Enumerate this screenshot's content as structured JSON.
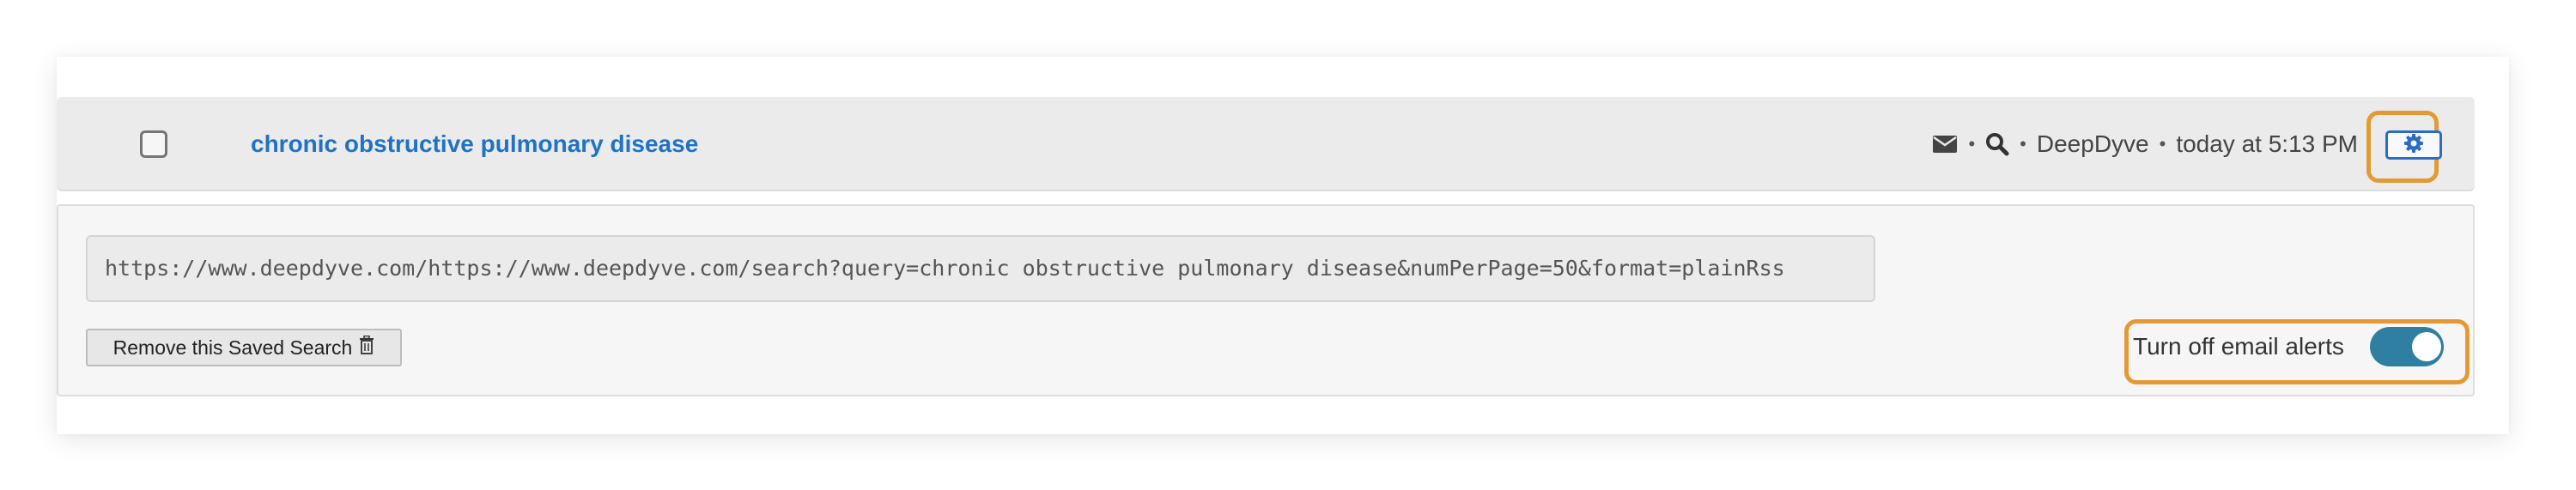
{
  "saved_search": {
    "selected": false,
    "title": "chronic obstructive pulmonary disease",
    "meta": {
      "mail_icon": "envelope-icon",
      "search_icon": "magnifier-icon",
      "separator": "•",
      "source": "DeepDyve",
      "timestamp": "today at 5:13 PM"
    },
    "settings_icon": "gear-icon",
    "url": "https://www.deepdyve.com/https://www.deepdyve.com/search?query=chronic obstructive pulmonary disease&numPerPage=50&format=plainRss",
    "remove_label": "Remove this Saved Search",
    "remove_icon": "trash-icon",
    "email_alerts": {
      "label": "Turn off email alerts",
      "enabled": true
    }
  },
  "colors": {
    "title": "#1f72c6",
    "toggle_on": "#2f7fa2",
    "highlight": "#e39a35",
    "header_bg": "#ebebeb"
  }
}
